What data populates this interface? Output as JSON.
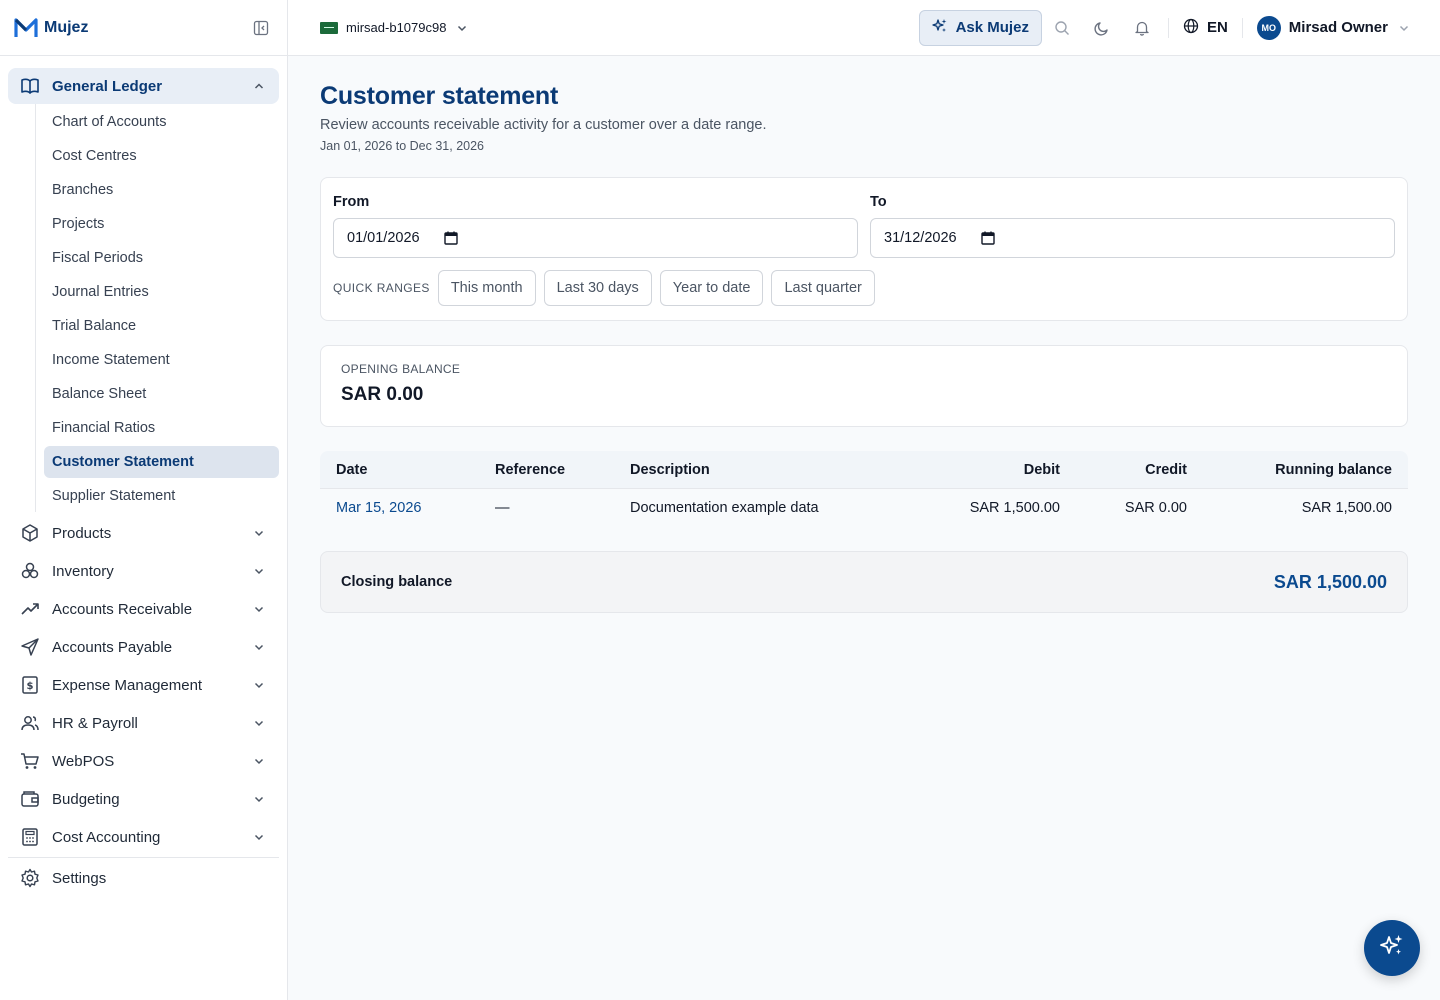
{
  "brand": {
    "name": "Mujez"
  },
  "colors": {
    "primary": "#0b3a75",
    "accent": "#0b4a8f",
    "active_bg": "#dde4ee"
  },
  "sidebar": {
    "group": {
      "label": "General Ledger",
      "icon": "book-icon",
      "items": [
        {
          "label": "Chart of Accounts"
        },
        {
          "label": "Cost Centres"
        },
        {
          "label": "Branches"
        },
        {
          "label": "Projects"
        },
        {
          "label": "Fiscal Periods"
        },
        {
          "label": "Journal Entries"
        },
        {
          "label": "Trial Balance"
        },
        {
          "label": "Income Statement"
        },
        {
          "label": "Balance Sheet"
        },
        {
          "label": "Financial Ratios"
        },
        {
          "label": "Customer Statement",
          "active": true
        },
        {
          "label": "Supplier Statement"
        }
      ]
    },
    "items": [
      {
        "label": "Products",
        "icon": "box-icon"
      },
      {
        "label": "Inventory",
        "icon": "boxes-icon"
      },
      {
        "label": "Accounts Receivable",
        "icon": "trending-up-icon"
      },
      {
        "label": "Accounts Payable",
        "icon": "send-icon"
      },
      {
        "label": "Expense Management",
        "icon": "receipt-dollar-icon"
      },
      {
        "label": "HR & Payroll",
        "icon": "users-icon"
      },
      {
        "label": "WebPOS",
        "icon": "cart-icon"
      },
      {
        "label": "Budgeting",
        "icon": "wallet-icon"
      },
      {
        "label": "Cost Accounting",
        "icon": "calculator-icon"
      }
    ],
    "settings": {
      "label": "Settings",
      "icon": "gear-icon"
    }
  },
  "topbar": {
    "company": "mirsad-b1079c98",
    "ask_label": "Ask Mujez",
    "language": "EN",
    "user_initials": "MO",
    "user_name": "Mirsad Owner"
  },
  "page": {
    "title": "Customer statement",
    "subtitle": "Review accounts receivable activity for a customer over a date range.",
    "range": "Jan 01, 2026 to Dec 31, 2026"
  },
  "filters": {
    "from_label": "From",
    "from_value": "01/01/2026",
    "to_label": "To",
    "to_value": "31/12/2026",
    "quick_label": "QUICK RANGES",
    "quick": [
      "This month",
      "Last 30 days",
      "Year to date",
      "Last quarter"
    ]
  },
  "opening": {
    "label": "OPENING BALANCE",
    "value": "SAR 0.00"
  },
  "table": {
    "headers": [
      "Date",
      "Reference",
      "Description",
      "Debit",
      "Credit",
      "Running balance"
    ],
    "rows": [
      {
        "date": "Mar 15, 2026",
        "reference": "—",
        "description": "Documentation example data",
        "debit": "SAR 1,500.00",
        "credit": "SAR 0.00",
        "running": "SAR 1,500.00"
      }
    ]
  },
  "closing": {
    "label": "Closing balance",
    "value": "SAR 1,500.00"
  }
}
